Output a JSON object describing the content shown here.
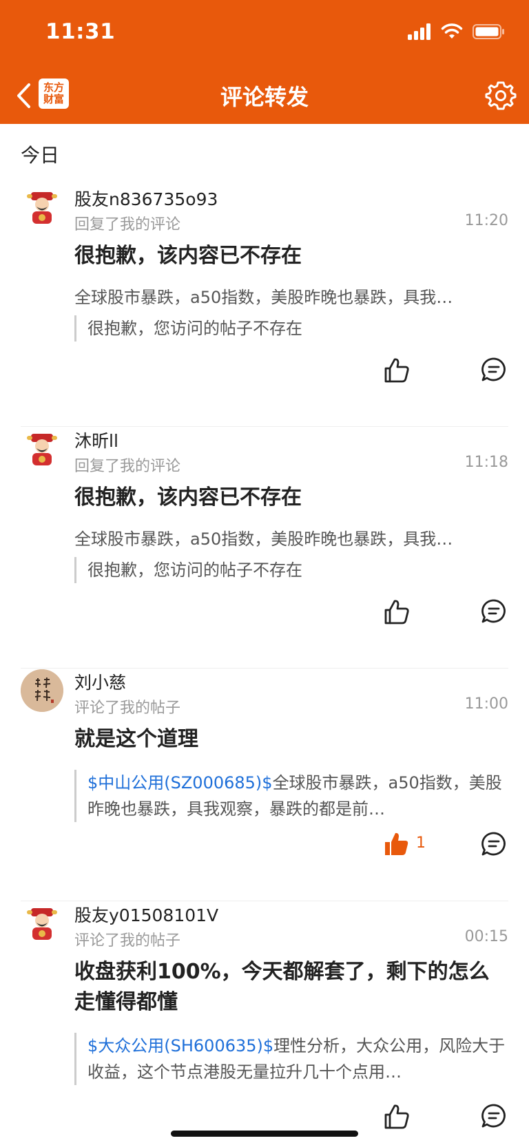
{
  "status_bar": {
    "time": "11:31"
  },
  "navbar": {
    "title": "评论转发",
    "logo_line1": "东方",
    "logo_line2": "财富",
    "icons": {
      "back": "chevron-left-icon",
      "settings": "gear-icon"
    }
  },
  "section_label": "今日",
  "colors": {
    "brand": "#E8590C",
    "link": "#1E6FD9",
    "muted": "#999999"
  },
  "comments": [
    {
      "username": "股友n836735o93",
      "action": "回复了我的评论",
      "time": "11:20",
      "content": "很抱歉，该内容已不存在",
      "original": "全球股市暴跌，a50指数，美股昨晚也暴跌，具我…",
      "quote": "很抱歉，您访问的帖子不存在",
      "avatar": "god-of-wealth-avatar"
    },
    {
      "username": "沐昕ll",
      "action": "回复了我的评论",
      "time": "11:18",
      "content": "很抱歉，该内容已不存在",
      "original": "全球股市暴跌，a50指数，美股昨晚也暴跌，具我…",
      "quote": "很抱歉，您访问的帖子不存在",
      "avatar": "god-of-wealth-avatar"
    },
    {
      "username": "刘小慈",
      "action": "评论了我的帖子",
      "time": "11:00",
      "content": "就是这个道理",
      "quote_stock": "$中山公用(SZ000685)$",
      "quote": "全球股市暴跌，a50指数，美股昨晚也暴跌，具我观察，暴跌的都是前…",
      "like_count": "1",
      "avatar": "calligraphy-avatar"
    },
    {
      "username": "股友y01508101V",
      "action": "评论了我的帖子",
      "time": "00:15",
      "content": "收盘获利100%，今天都解套了，剩下的怎么走懂得都懂",
      "quote_stock": "$大众公用(SH600635)$",
      "quote": "理性分析，大众公用，风险大于收益，这个节点港股无量拉升几十个点用…",
      "avatar": "god-of-wealth-avatar"
    }
  ]
}
